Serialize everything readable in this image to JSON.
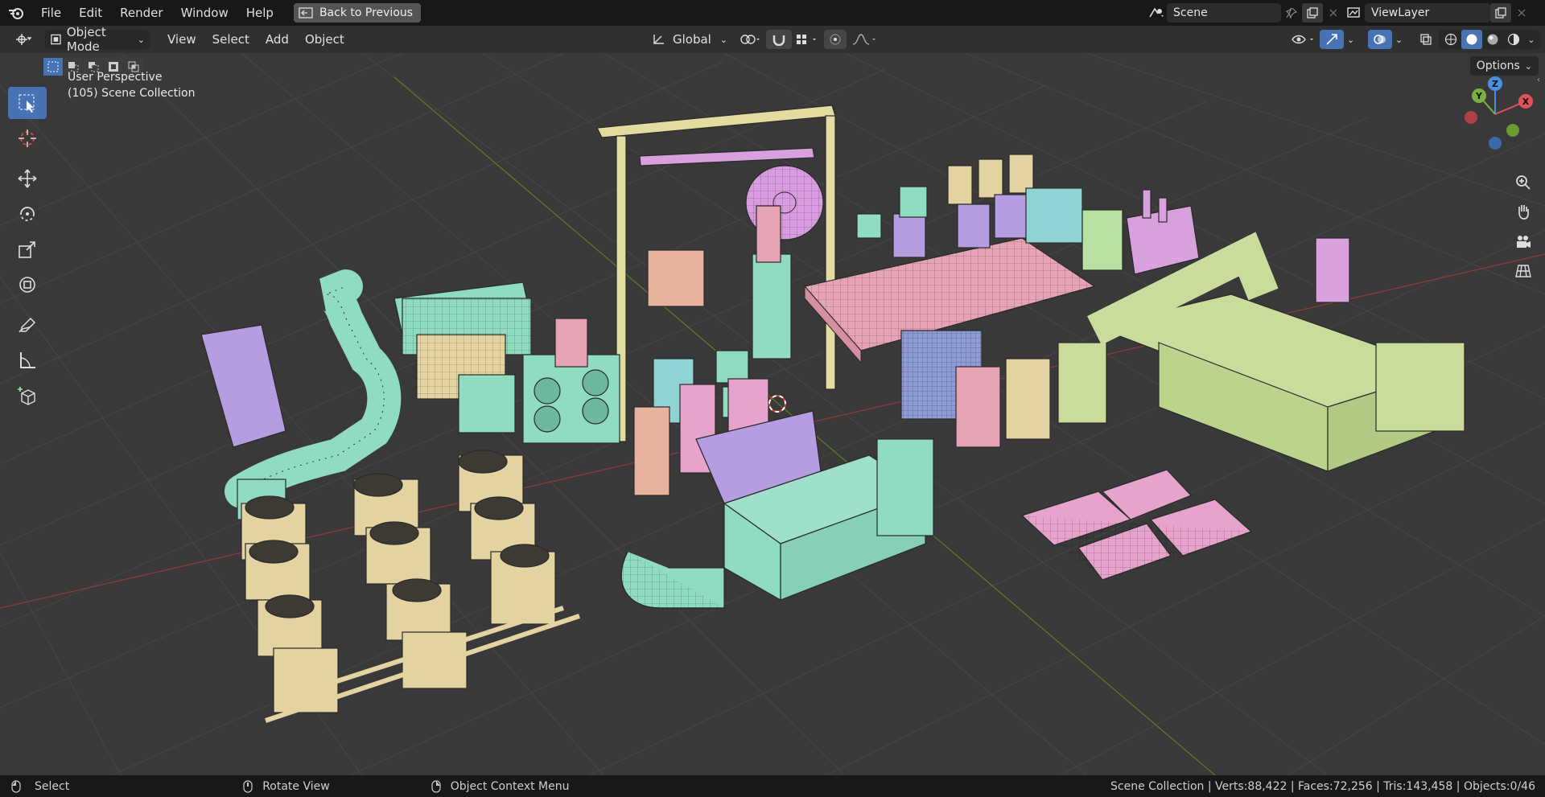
{
  "menubar": {
    "items": [
      "File",
      "Edit",
      "Render",
      "Window",
      "Help"
    ],
    "back_button": "Back to Previous",
    "scene": "Scene",
    "view_layer": "ViewLayer"
  },
  "header": {
    "mode": "Object Mode",
    "menus": [
      "View",
      "Select",
      "Add",
      "Object"
    ],
    "transform_orientation": "Global",
    "options": "Options"
  },
  "viewport": {
    "view_name": "User Perspective",
    "collection": "(105) Scene Collection",
    "gizmo_axes": [
      "X",
      "Y",
      "Z"
    ]
  },
  "statusbar": {
    "select": "Select",
    "rotate": "Rotate View",
    "context": "Object Context Menu",
    "stats": "Scene Collection | Verts:88,422 | Faces:72,256 | Tris:143,458 | Objects:0/46"
  },
  "colors": {
    "accent": "#4772b3",
    "mint": "#8fdcc0",
    "tan": "#e3d3a0",
    "pink": "#e6a3b4",
    "lavender": "#b69ce0",
    "yellowgreen": "#c9dc9c",
    "periwinkle": "#8e9bd6",
    "orchid": "#d8a1dd"
  }
}
